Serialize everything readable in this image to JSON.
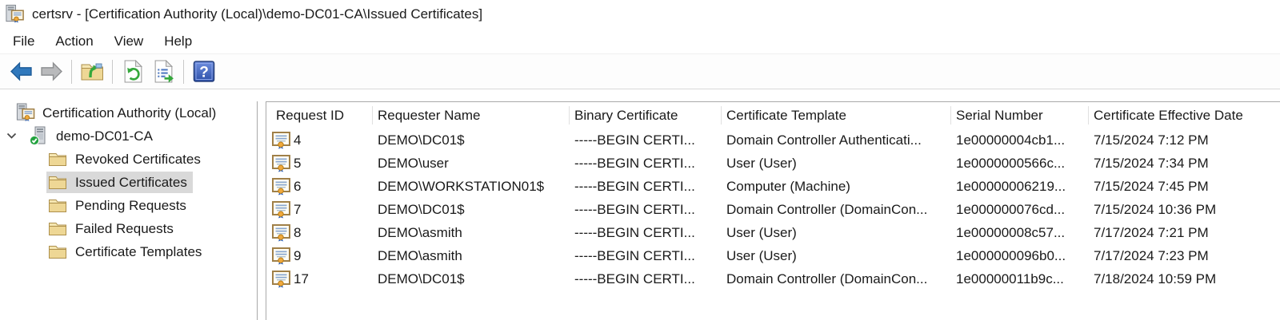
{
  "window": {
    "title": "certsrv - [Certification Authority (Local)\\demo-DC01-CA\\Issued Certificates]"
  },
  "menu": {
    "items": [
      {
        "label": "File"
      },
      {
        "label": "Action"
      },
      {
        "label": "View"
      },
      {
        "label": "Help"
      }
    ]
  },
  "toolbar": {
    "buttons": [
      {
        "name": "back",
        "icon": "back-arrow-icon"
      },
      {
        "name": "forward",
        "icon": "forward-arrow-icon"
      },
      {
        "name": "show-console-tree",
        "icon": "folder-up-arrow-icon"
      },
      {
        "name": "refresh",
        "icon": "refresh-icon"
      },
      {
        "name": "export-list",
        "icon": "export-list-icon"
      },
      {
        "name": "help",
        "icon": "help-icon"
      }
    ]
  },
  "tree": {
    "root": {
      "label": "Certification Authority (Local)",
      "icon": "certification-authority-icon"
    },
    "ca": {
      "label": "demo-DC01-CA",
      "icon": "server-check-icon",
      "expanded": true
    },
    "children": [
      {
        "label": "Revoked Certificates",
        "selected": false
      },
      {
        "label": "Issued Certificates",
        "selected": true
      },
      {
        "label": "Pending Requests",
        "selected": false
      },
      {
        "label": "Failed Requests",
        "selected": false
      },
      {
        "label": "Certificate Templates",
        "selected": false
      }
    ]
  },
  "table": {
    "columns": [
      "Request ID",
      "Requester Name",
      "Binary Certificate",
      "Certificate Template",
      "Serial Number",
      "Certificate Effective Date"
    ],
    "rows": [
      {
        "request_id": "4",
        "requester_name": "DEMO\\DC01$",
        "binary_certificate": "-----BEGIN CERTI...",
        "certificate_template": "Domain Controller Authenticati...",
        "serial_number": "1e00000004cb1...",
        "effective_date": "7/15/2024 7:12 PM"
      },
      {
        "request_id": "5",
        "requester_name": "DEMO\\user",
        "binary_certificate": "-----BEGIN CERTI...",
        "certificate_template": "User (User)",
        "serial_number": "1e0000000566c...",
        "effective_date": "7/15/2024 7:34 PM"
      },
      {
        "request_id": "6",
        "requester_name": "DEMO\\WORKSTATION01$",
        "binary_certificate": "-----BEGIN CERTI...",
        "certificate_template": "Computer (Machine)",
        "serial_number": "1e00000006219...",
        "effective_date": "7/15/2024 7:45 PM"
      },
      {
        "request_id": "7",
        "requester_name": "DEMO\\DC01$",
        "binary_certificate": "-----BEGIN CERTI...",
        "certificate_template": "Domain Controller (DomainCon...",
        "serial_number": "1e000000076cd...",
        "effective_date": "7/15/2024 10:36 PM"
      },
      {
        "request_id": "8",
        "requester_name": "DEMO\\asmith",
        "binary_certificate": "-----BEGIN CERTI...",
        "certificate_template": "User (User)",
        "serial_number": "1e00000008c57...",
        "effective_date": "7/17/2024 7:21 PM"
      },
      {
        "request_id": "9",
        "requester_name": "DEMO\\asmith",
        "binary_certificate": "-----BEGIN CERTI...",
        "certificate_template": "User (User)",
        "serial_number": "1e000000096b0...",
        "effective_date": "7/17/2024 7:23 PM"
      },
      {
        "request_id": "17",
        "requester_name": "DEMO\\DC01$",
        "binary_certificate": "-----BEGIN CERTI...",
        "certificate_template": "Domain Controller (DomainCon...",
        "serial_number": "1e00000011b9c...",
        "effective_date": "7/18/2024 10:59 PM"
      }
    ]
  },
  "colors": {
    "selection_inactive": "#d9d9d9",
    "folder_fill": "#f0d999",
    "accent_green": "#35a83c",
    "back_arrow_blue": "#3179bd",
    "help_blue": "#3a5bc4"
  }
}
